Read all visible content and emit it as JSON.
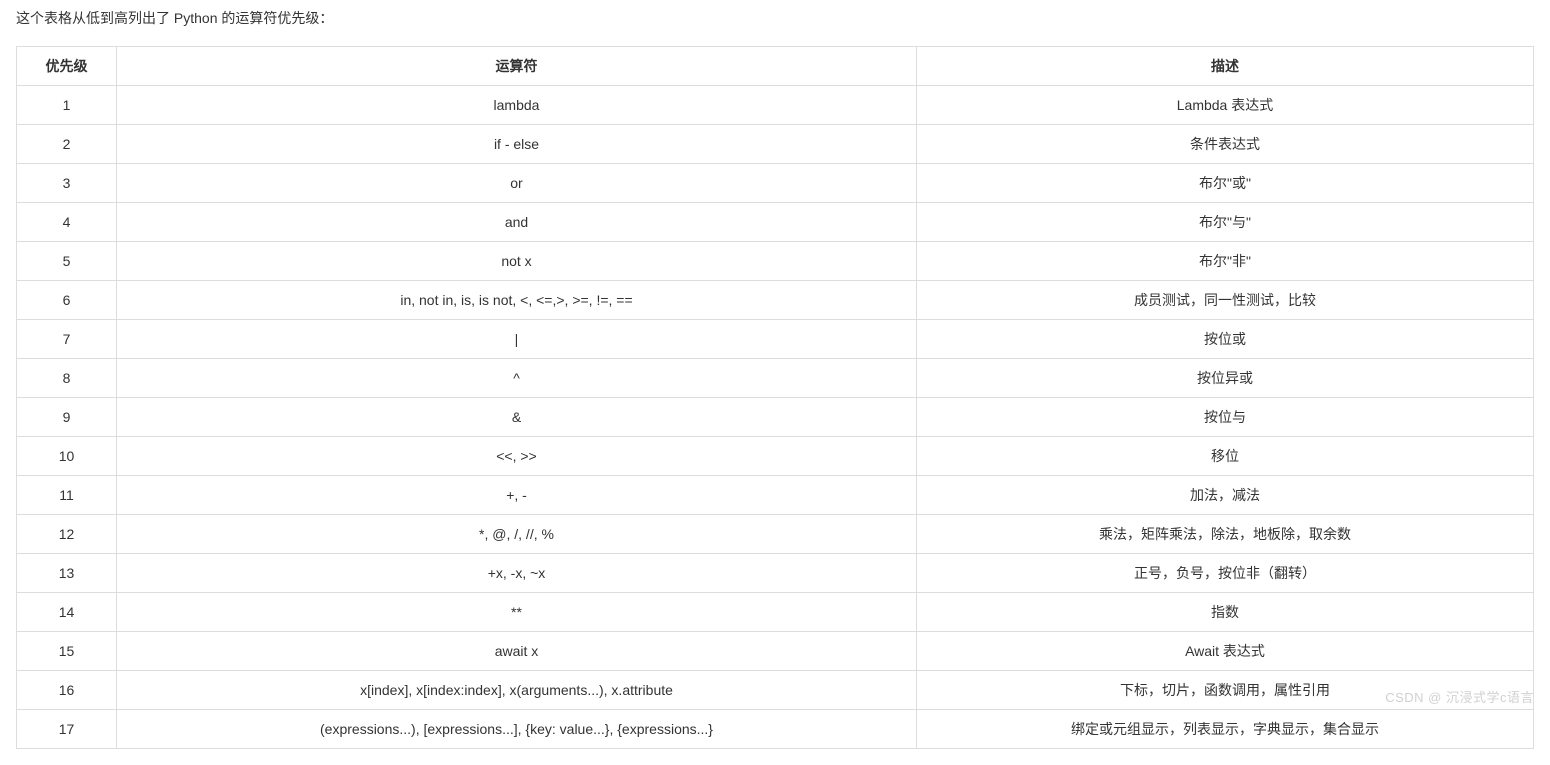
{
  "intro": "这个表格从低到高列出了 Python 的运算符优先级：",
  "headers": {
    "priority": "优先级",
    "operator": "运算符",
    "description": "描述"
  },
  "rows": [
    {
      "priority": "1",
      "operator": "lambda",
      "description": "Lambda 表达式"
    },
    {
      "priority": "2",
      "operator": "if - else",
      "description": "条件表达式"
    },
    {
      "priority": "3",
      "operator": "or",
      "description": "布尔\"或\""
    },
    {
      "priority": "4",
      "operator": "and",
      "description": "布尔\"与\""
    },
    {
      "priority": "5",
      "operator": "not x",
      "description": "布尔\"非\""
    },
    {
      "priority": "6",
      "operator": "in, not in, is, is not, <, <=,>, >=, !=, ==",
      "description": "成员测试，同一性测试，比较"
    },
    {
      "priority": "7",
      "operator": "|",
      "description": "按位或"
    },
    {
      "priority": "8",
      "operator": "^",
      "description": "按位异或"
    },
    {
      "priority": "9",
      "operator": "&",
      "description": "按位与"
    },
    {
      "priority": "10",
      "operator": "<<, >>",
      "description": "移位"
    },
    {
      "priority": "11",
      "operator": "+, -",
      "description": "加法，减法"
    },
    {
      "priority": "12",
      "operator": "*, @, /, //, %",
      "description": "乘法，矩阵乘法，除法，地板除，取余数"
    },
    {
      "priority": "13",
      "operator": "+x,  -x, ~x",
      "description": "正号，负号，按位非（翻转）"
    },
    {
      "priority": "14",
      "operator": "**",
      "description": "指数"
    },
    {
      "priority": "15",
      "operator": "await x",
      "description": "Await 表达式"
    },
    {
      "priority": "16",
      "operator": "x[index], x[index:index], x(arguments...), x.attribute",
      "description": "下标，切片，函数调用，属性引用"
    },
    {
      "priority": "17",
      "operator": "(expressions...), [expressions...], {key: value...}, {expressions...}",
      "description": "绑定或元组显示，列表显示，字典显示，集合显示"
    }
  ],
  "watermark": "CSDN @ 沉浸式学c语言"
}
